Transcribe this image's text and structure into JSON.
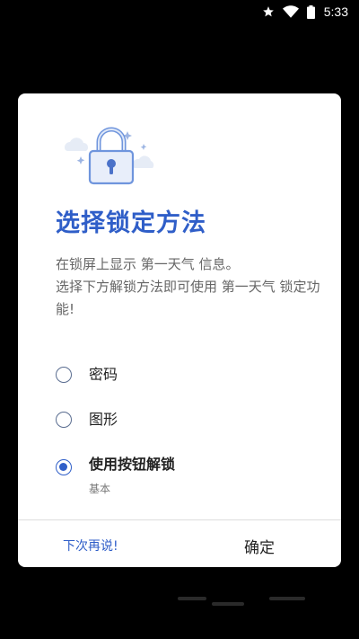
{
  "status_bar": {
    "time": "5:33",
    "icons": [
      "star-icon",
      "wifi-icon",
      "battery-icon"
    ]
  },
  "dialog": {
    "title": "选择锁定方法",
    "description_line1": "在锁屏上显示 第一天气 信息。",
    "description_line2": "选择下方解锁方法即可使用 第一天气 锁定功能!",
    "options": [
      {
        "label": "密码",
        "checked": false
      },
      {
        "label": "图形",
        "checked": false
      },
      {
        "label": "使用按钮解锁",
        "sublabel": "基本",
        "checked": true
      }
    ],
    "later_button": "下次再说!",
    "ok_button": "确定",
    "accent_color": "#2f5ec8"
  }
}
